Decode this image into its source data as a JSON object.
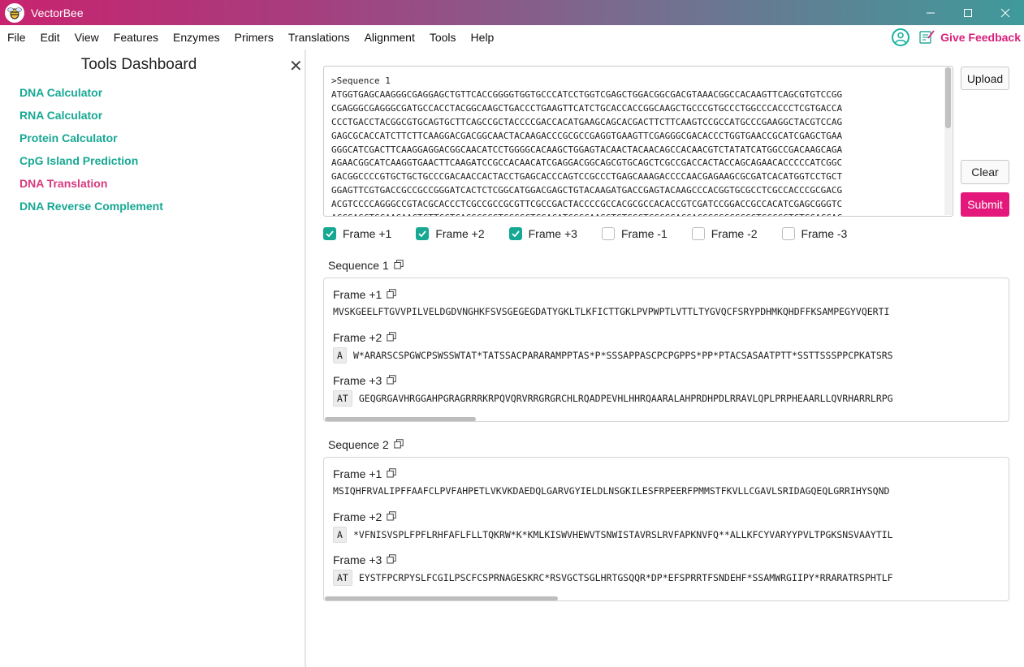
{
  "app": {
    "title": "VectorBee"
  },
  "window_controls": [
    "minimize",
    "maximize",
    "close"
  ],
  "menu": [
    "File",
    "Edit",
    "View",
    "Features",
    "Enzymes",
    "Primers",
    "Translations",
    "Alignment",
    "Tools",
    "Help"
  ],
  "header": {
    "feedback_label": "Give Feedback"
  },
  "sidebar": {
    "title": "Tools Dashboard",
    "close_label": "✕",
    "tools": [
      "DNA Calculator",
      "RNA Calculator",
      "Protein Calculator",
      "CpG Island Prediction",
      "DNA Translation",
      "DNA Reverse Complement"
    ],
    "active_tool": "DNA Translation"
  },
  "input": {
    "lines": [
      ">Sequence 1",
      "ATGGTGAGCAAGGGCGAGGAGCTGTTCACCGGGGTGGTGCCCATCCTGGTCGAGCTGGACGGCGACGTAAACGGCCACAAGTTCAGCGTGTCCGG",
      "CGAGGGCGAGGGCGATGCCACCTACGGCAAGCTGACCCTGAAGTTCATCTGCACCACCGGCAAGCTGCCCGTGCCCTGGCCCACCCTCGTGACCA",
      "CCCTGACCTACGGCGTGCAGTGCTTCAGCCGCTACCCCGACCACATGAAGCAGCACGACTTCTTCAAGTCCGCCATGCCCGAAGGCTACGTCCAG",
      "GAGCGCACCATCTTCTTCAAGGACGACGGCAACTACAAGACCCGCGCCGAGGTGAAGTTCGAGGGCGACACCCTGGTGAACCGCATCGAGCTGAA",
      "GGGCATCGACTTCAAGGAGGACGGCAACATCCTGGGGCACAAGCTGGAGTACAACTACAACAGCCACAACGTCTATATCATGGCCGACAAGCAGA",
      "AGAACGGCATCAAGGTGAACTTCAAGATCCGCCACAACATCGAGGACGGCAGCGTGCAGCTCGCCGACCACTACCAGCAGAACACCCCCATCGGC",
      "GACGGCCCCGTGCTGCTGCCCGACAACCACTACCTGAGCACCCAGTCCGCCCTGAGCAAAGACCCCAACGAGAAGCGCGATCACATGGTCCTGCT",
      "GGAGTTCGTGACCGCCGCCGGGATCACTCTCGGCATGGACGAGCTGTACAAGATGACCGAGTACAAGCCCACGGTGCGCCTCGCCACCCGCGACG",
      "ACGTCCCCAGGGCCGTACGCACCCTCGCCGCCGCGTTCGCCGACTACCCCGCCACGCGCCACACCGTCGATCCGGACCGCCACATCGAGCGGGTC",
      "ACCGAGCTGCAAGAACTCTTCCTCACGCGCGTCGGGCTCGACATCGGCAAGGTGTGGGTCGCGGACGACGGCGCCGCGGTGGCGGTCTGGACCAC"
    ]
  },
  "buttons": {
    "upload": "Upload",
    "clear": "Clear",
    "submit": "Submit"
  },
  "frame_options": [
    {
      "label": "Frame +1",
      "checked": true
    },
    {
      "label": "Frame +2",
      "checked": true
    },
    {
      "label": "Frame +3",
      "checked": true
    },
    {
      "label": "Frame -1",
      "checked": false
    },
    {
      "label": "Frame -2",
      "checked": false
    },
    {
      "label": "Frame -3",
      "checked": false
    }
  ],
  "results": [
    {
      "title": "Sequence 1",
      "frames": [
        {
          "label": "Frame +1",
          "pad": "",
          "protein": "MVSKGEELFTGVVPILVELDGDVNGHKFSVSGEGEGDATYGKLTLKFICTTGKLPVPWPTLVTTLTYGVQCFSRYPDHMKQHDFFKSAMPEGYVQERTI"
        },
        {
          "label": "Frame +2",
          "pad": "A",
          "protein": "W*ARARSCSPGWCPSWSSWTAT*TATSSACPARARAMPPTAS*P*SSSAPPASCPCPGPPS*PP*PTACSASAATPTT*SSTTSSSPPCPKATSRS"
        },
        {
          "label": "Frame +3",
          "pad": "AT",
          "protein": "GEQGRGAVHRGGAHPGRAGRRRKRPQVQRVRRGRGRCHLRQADPEVHLHHRQAARALAHPRDHPDLRRAVLQPLPRPHEAARLLQVRHARRLRPG"
        }
      ],
      "scroll_fraction": 0.22
    },
    {
      "title": "Sequence 2",
      "frames": [
        {
          "label": "Frame +1",
          "pad": "",
          "protein": "MSIQHFRVALIPFFAAFCLPVFAHPETLVKVKDAEDQLGARVGYIELDLNSGKILESFRPEERFPMMSTFKVLLCGAVLSRIDAGQEQLGRRIHYSQND"
        },
        {
          "label": "Frame +2",
          "pad": "A",
          "protein": "*VFNISVSPLFPFLRHFAFLFLLTQKRW*K*KMLKISWVHEWVTSNWISTAVRSLRVFAPKNVFQ**ALLKFCYVARYYPVLTPGKSNSVAAYTIL"
        },
        {
          "label": "Frame +3",
          "pad": "AT",
          "protein": "EYSTFPCRPYSLFCGILPSCFCSPRNAGESKRC*RSVGCTSGLHRTGSQQR*DP*EFSPRRTFSNDEHF*SSAMWRGIIPY*RRARATRSPHTLF"
        }
      ],
      "scroll_fraction": 0.34
    }
  ]
}
